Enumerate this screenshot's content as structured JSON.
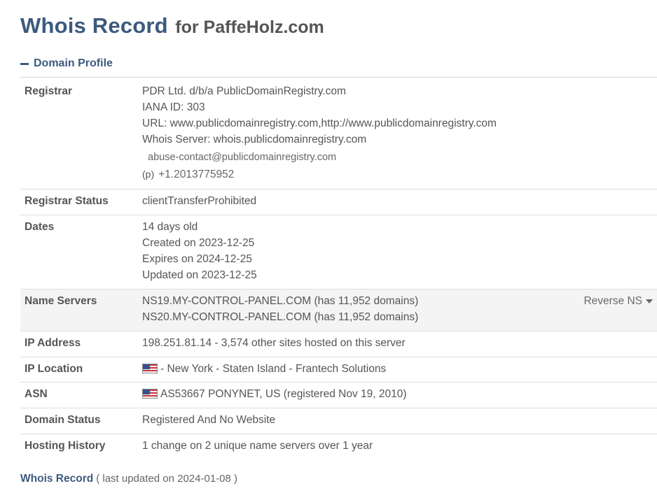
{
  "header": {
    "title": "Whois Record",
    "subtitle": "for PaffeHolz.com"
  },
  "section": {
    "label": "Domain Profile"
  },
  "rows": {
    "registrar": {
      "label": "Registrar",
      "lines": [
        "PDR Ltd. d/b/a PublicDomainRegistry.com",
        "IANA ID: 303",
        "URL: www.publicdomainregistry.com,http://www.publicdomainregistry.com",
        "Whois Server: whois.publicdomainregistry.com"
      ],
      "email": "abuse-contact@publicdomainregistry.com",
      "phone_prefix": "(p)",
      "phone": "+1.2013775952"
    },
    "registrar_status": {
      "label": "Registrar Status",
      "value": "clientTransferProhibited"
    },
    "dates": {
      "label": "Dates",
      "lines": [
        "14 days old",
        "Created on 2023-12-25",
        "Expires on 2024-12-25",
        "Updated on 2023-12-25"
      ]
    },
    "name_servers": {
      "label": "Name Servers",
      "lines": [
        "NS19.MY-CONTROL-PANEL.COM (has 11,952 domains)",
        "NS20.MY-CONTROL-PANEL.COM (has 11,952 domains)"
      ],
      "reverse_label": "Reverse NS"
    },
    "ip_address": {
      "label": "IP Address",
      "value": "198.251.81.14 - 3,574 other sites hosted on this server"
    },
    "ip_location": {
      "label": "IP Location",
      "value": "- New York - Staten Island - Frantech Solutions",
      "flag_icon": "us-flag-icon"
    },
    "asn": {
      "label": "ASN",
      "value": "AS53667 PONYNET, US (registered Nov 19, 2010)",
      "flag_icon": "us-flag-icon"
    },
    "domain_status": {
      "label": "Domain Status",
      "value": "Registered And No Website"
    },
    "hosting_history": {
      "label": "Hosting History",
      "value": "1 change on 2 unique name servers over 1 year"
    }
  },
  "footer": {
    "link": "Whois Record",
    "updated": "( last updated on 2024-01-08 )"
  },
  "colors": {
    "accent": "#3c5a7e",
    "text": "#555555",
    "row_shade": "#f4f4f4",
    "divider": "#dedede"
  }
}
